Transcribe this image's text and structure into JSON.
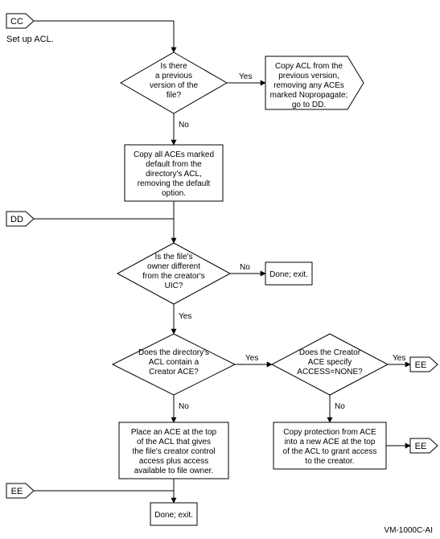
{
  "connectors": {
    "cc": "CC",
    "dd": "DD",
    "ee": "EE"
  },
  "labels": {
    "setup": "Set up ACL.",
    "yes": "Yes",
    "no": "No",
    "footer": "VM-1000C-AI"
  },
  "decisions": {
    "prev_version": {
      "l1": "Is there",
      "l2": "a previous",
      "l3": "version of the",
      "l4": "file?"
    },
    "owner_diff": {
      "l1": "Is the file's",
      "l2": "owner different",
      "l3": "from the creator's",
      "l4": "UIC?"
    },
    "has_creator_ace": {
      "l1": "Does the directory's",
      "l2": "ACL contain a",
      "l3": "Creator ACE?"
    },
    "access_none": {
      "l1": "Does the Creator",
      "l2": "ACE specify",
      "l3": "ACCESS=NONE?"
    }
  },
  "processes": {
    "copy_prev": {
      "l1": "Copy ACL from the",
      "l2": "previous version,",
      "l3": "removing any ACEs",
      "l4": "marked Nopropagate;",
      "l5": "go to DD."
    },
    "copy_defaults": {
      "l1": "Copy all ACEs marked",
      "l2": "default from the",
      "l3": "directory's ACL,",
      "l4": "removing the default",
      "l5": "option."
    },
    "place_ace": {
      "l1": "Place an ACE at the top",
      "l2": "of the ACL that gives",
      "l3": "the file's creator control",
      "l4": "access plus access",
      "l5": "available to file owner."
    },
    "copy_protection": {
      "l1": "Copy protection from ACE",
      "l2": "into a new ACE at the top",
      "l3": "of the ACL to grant access",
      "l4": "to the creator."
    },
    "done_exit": "Done; exit."
  }
}
